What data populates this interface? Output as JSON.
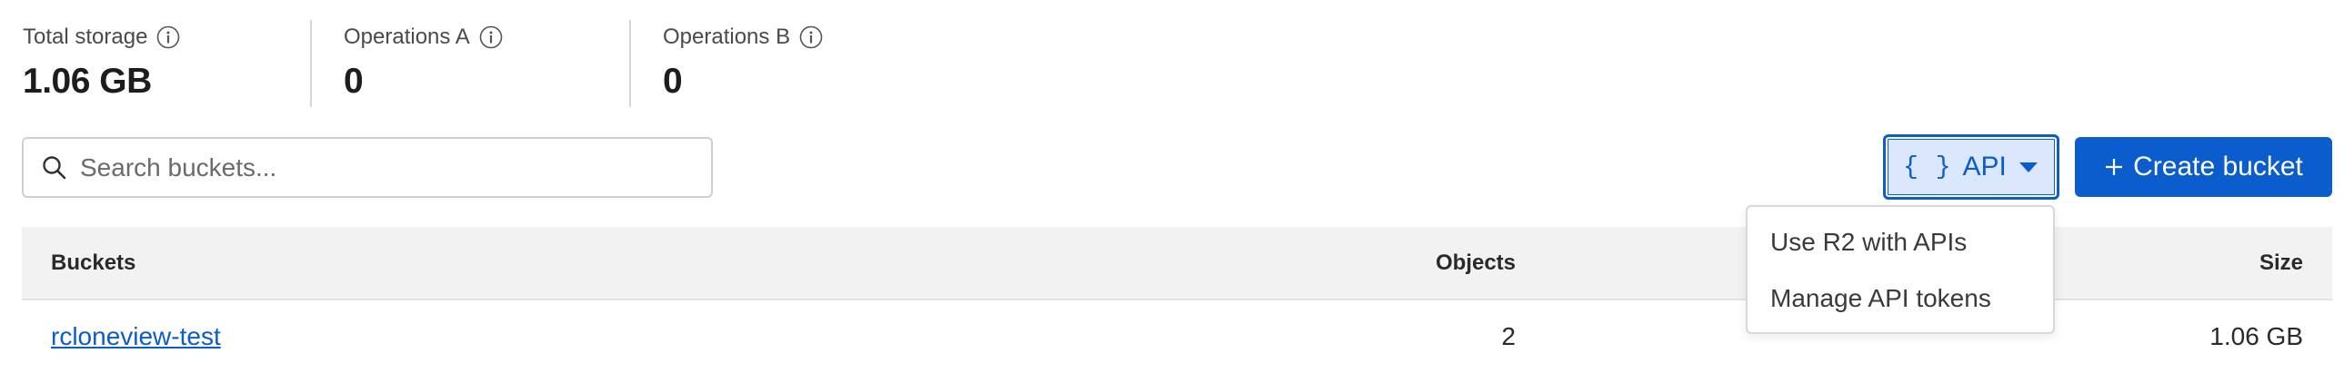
{
  "metrics": [
    {
      "label": "Total storage",
      "value": "1.06 GB",
      "icon": "info-icon"
    },
    {
      "label": "Operations A",
      "value": "0",
      "icon": "info-icon"
    },
    {
      "label": "Operations B",
      "value": "0",
      "icon": "info-icon"
    }
  ],
  "search": {
    "placeholder": "Search buckets...",
    "value": ""
  },
  "toolbar": {
    "api_braces": "{ }",
    "api_label": "API",
    "create_label": "Create bucket"
  },
  "api_menu": {
    "items": [
      {
        "label": "Use R2 with APIs"
      },
      {
        "label": "Manage API tokens"
      }
    ]
  },
  "table": {
    "columns": {
      "buckets": "Buckets",
      "objects": "Objects",
      "size": "Size"
    },
    "rows": [
      {
        "name": "rcloneview-test",
        "objects": "2",
        "size": "1.06 GB"
      }
    ]
  },
  "colors": {
    "accent": "#0b5ccd",
    "api_button_bg": "#dbe8fb",
    "header_bg": "#f2f2f2"
  }
}
